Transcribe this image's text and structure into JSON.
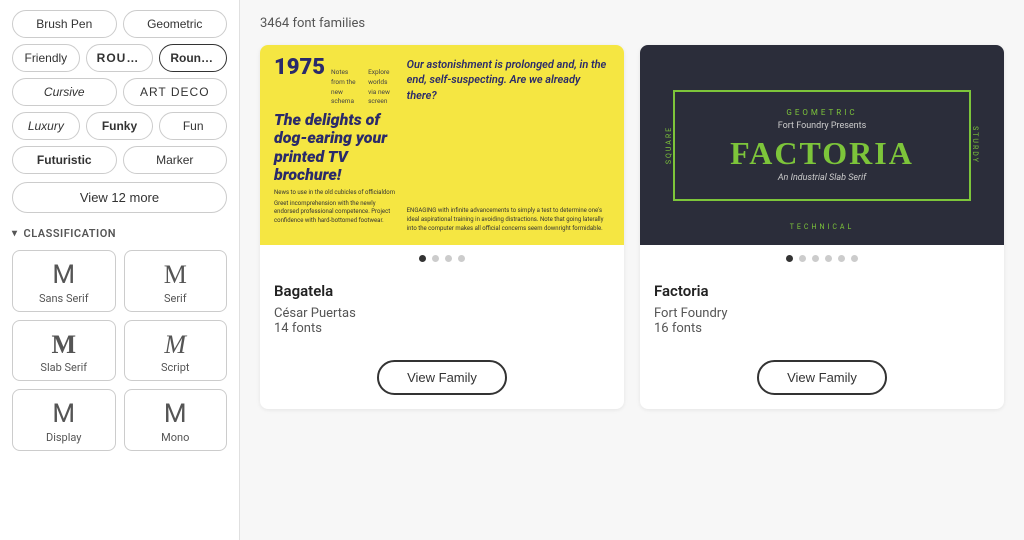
{
  "sidebar": {
    "tags_row1": [
      {
        "id": "brush-pen",
        "label": "Brush Pen",
        "style": ""
      },
      {
        "id": "geometric",
        "label": "Geometric",
        "style": ""
      }
    ],
    "tags_row2": [
      {
        "id": "friendly",
        "label": "Friendly",
        "style": ""
      },
      {
        "id": "rough",
        "label": "ROUGH",
        "style": "rough"
      },
      {
        "id": "rounded",
        "label": "Rounded",
        "style": "active"
      }
    ],
    "tags_row3": [
      {
        "id": "cursive",
        "label": "Cursive",
        "style": "cursive"
      },
      {
        "id": "art-deco",
        "label": "ART DECO",
        "style": "artdeco"
      }
    ],
    "tags_row4": [
      {
        "id": "luxury",
        "label": "Luxury",
        "style": "luxury"
      },
      {
        "id": "funky",
        "label": "Funky",
        "style": "funky"
      },
      {
        "id": "fun",
        "label": "Fun",
        "style": ""
      }
    ],
    "tags_row5": [
      {
        "id": "futuristic",
        "label": "Futuristic",
        "style": "futuristic"
      },
      {
        "id": "marker",
        "label": "Marker",
        "style": ""
      }
    ],
    "view_more_label": "View 12 more",
    "classification_label": "CLASSIFICATION",
    "classification_items": [
      {
        "id": "sans-serif",
        "letter": "M",
        "label": "Sans Serif",
        "style": "sans"
      },
      {
        "id": "serif",
        "letter": "M",
        "label": "Serif",
        "style": "serif"
      },
      {
        "id": "slab-serif",
        "letter": "M",
        "label": "Slab Serif",
        "style": "slab"
      },
      {
        "id": "script",
        "letter": "M",
        "label": "Script",
        "style": "script"
      },
      {
        "id": "display",
        "letter": "M",
        "label": "Display",
        "style": "display"
      },
      {
        "id": "mono",
        "letter": "M",
        "label": "Mono",
        "style": "mono"
      }
    ]
  },
  "main": {
    "result_count": "3464 font families",
    "cards": [
      {
        "id": "bagatela",
        "preview_year": "1975",
        "preview_notes1": "Notes from the",
        "preview_notes2": "new schema",
        "preview_explore1": "Explore worlds",
        "preview_explore2": "via new screen",
        "preview_headline": "The delights of dog-earing your printed TV brochure!",
        "preview_quote": "Our astonishment is prolonged and, in the end, self-suspecting. Are we already there?",
        "preview_small1": "News to use in the old cubicles of officialdom",
        "preview_small2": "Greet incomprehension with the newly endorsed professional competence. Project confidence with hard-bottomed footwear.",
        "preview_engaging": "ENGAGING with infinite advancements to simply a test to determine one's ideal aspirational training in avoiding distractions. Note that going laterally into the computer makes all official concerns seem downright formidable.",
        "title": "Bagatela",
        "author": "César Puertas",
        "fonts": "14 fonts",
        "view_family_label": "View Family",
        "dots": [
          true,
          false,
          false,
          false
        ]
      },
      {
        "id": "factoria",
        "preview_geometric": "GEOMETRIC",
        "preview_presents": "Fort Foundry Presents",
        "preview_name": "FACTORIA",
        "preview_subtitle": "An Industrial Slab Serif",
        "preview_side_left": "SQUARE",
        "preview_side_right": "STURDY",
        "preview_bottom": "TECHNICAL",
        "title": "Factoria",
        "author": "Fort Foundry",
        "fonts": "16 fonts",
        "view_family_label": "View Family",
        "dots": [
          true,
          false,
          false,
          false,
          false,
          false
        ]
      }
    ]
  }
}
